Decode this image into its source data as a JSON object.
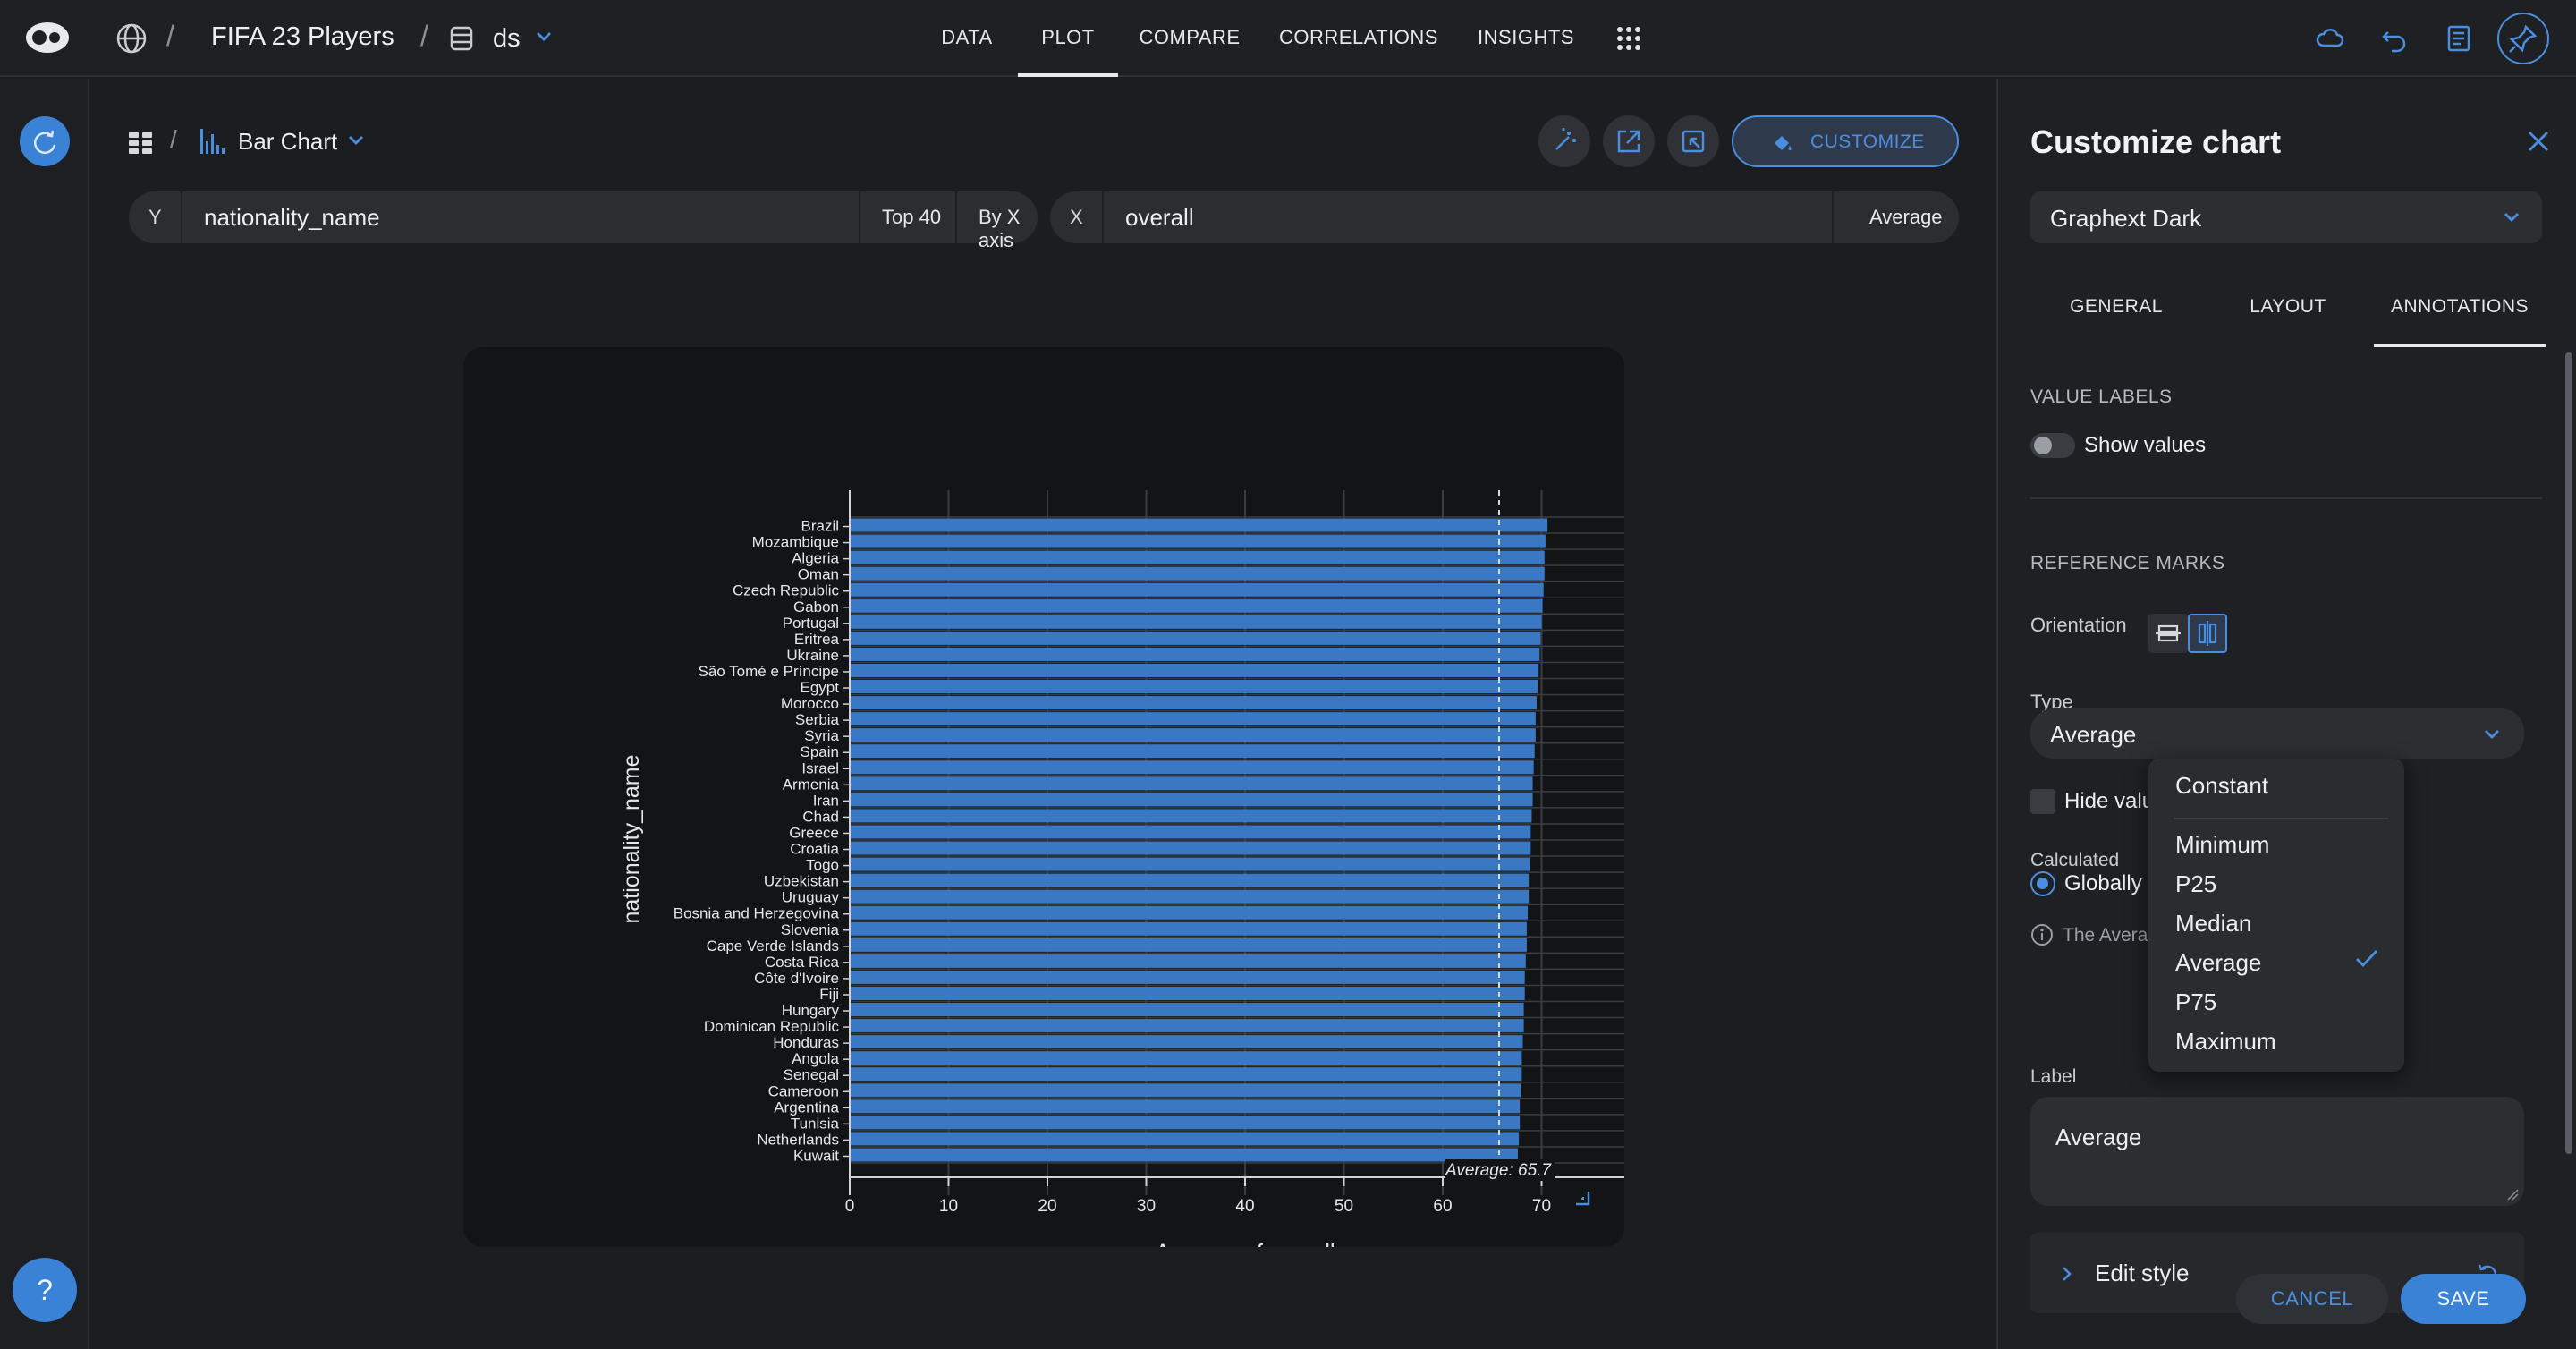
{
  "header": {
    "project": "FIFA 23 Players",
    "dataset": "ds",
    "tabs": [
      "DATA",
      "PLOT",
      "COMPARE",
      "CORRELATIONS",
      "INSIGHTS"
    ],
    "active_tab": "PLOT"
  },
  "toolbar": {
    "chart_type": "Bar Chart",
    "customize_label": "CUSTOMIZE"
  },
  "encoding": {
    "y_tag": "Y",
    "y_field": "nationality_name",
    "y_top": "Top 40",
    "y_sort": "By X axis",
    "x_tag": "X",
    "x_field": "overall",
    "x_agg": "Average"
  },
  "chart_data": {
    "type": "bar",
    "orientation": "horizontal",
    "categories": [
      "Brazil",
      "Mozambique",
      "Algeria",
      "Oman",
      "Czech Republic",
      "Gabon",
      "Portugal",
      "Eritrea",
      "Ukraine",
      "São Tomé e Príncipe",
      "Egypt",
      "Morocco",
      "Serbia",
      "Syria",
      "Spain",
      "Israel",
      "Armenia",
      "Iran",
      "Chad",
      "Greece",
      "Croatia",
      "Togo",
      "Uzbekistan",
      "Uruguay",
      "Bosnia and Herzegovina",
      "Slovenia",
      "Cape Verde Islands",
      "Costa Rica",
      "Côte d'Ivoire",
      "Fiji",
      "Hungary",
      "Dominican Republic",
      "Honduras",
      "Angola",
      "Senegal",
      "Cameroon",
      "Argentina",
      "Tunisia",
      "Netherlands",
      "Kuwait"
    ],
    "values": [
      70.6,
      70.4,
      70.3,
      70.3,
      70.2,
      70.1,
      70.0,
      69.9,
      69.8,
      69.7,
      69.6,
      69.5,
      69.4,
      69.4,
      69.3,
      69.2,
      69.1,
      69.1,
      69.0,
      68.9,
      68.9,
      68.8,
      68.7,
      68.7,
      68.6,
      68.5,
      68.5,
      68.4,
      68.3,
      68.3,
      68.2,
      68.2,
      68.1,
      68.0,
      68.0,
      67.9,
      67.8,
      67.8,
      67.7,
      67.6
    ],
    "xlabel": "Average of overall",
    "ylabel": "nationality_name",
    "xlim": [
      0,
      80
    ],
    "xticks": [
      0,
      10,
      20,
      30,
      40,
      50,
      60,
      70,
      80
    ],
    "reference_line": {
      "value": 65.7,
      "label": "Average: 65.7"
    },
    "bar_color": "#3a78c4"
  },
  "panel": {
    "title": "Customize chart",
    "theme": "Graphext Dark",
    "tabs": [
      "GENERAL",
      "LAYOUT",
      "ANNOTATIONS"
    ],
    "active_tab": "ANNOTATIONS",
    "value_labels_heading": "VALUE LABELS",
    "show_values_label": "Show values",
    "reference_marks_heading": "REFERENCE MARKS",
    "orientation_label": "Orientation",
    "type_label": "Type",
    "type_value": "Average",
    "hide_values_label": "Hide valu",
    "calculated_label": "Calculated",
    "globally_label": "Globally",
    "info_text": "The Avera",
    "label_label": "Label",
    "label_value": "Average",
    "edit_style_label": "Edit style",
    "cancel_label": "CANCEL",
    "save_label": "SAVE"
  },
  "type_dropdown": {
    "options": [
      "Constant",
      "Minimum",
      "P25",
      "Median",
      "Average",
      "P75",
      "Maximum"
    ],
    "selected": "Average"
  },
  "rail": {
    "help_label": "?"
  },
  "colors": {
    "accent": "#3a82d6",
    "bar": "#3a78c4",
    "background": "#1c1d20"
  }
}
